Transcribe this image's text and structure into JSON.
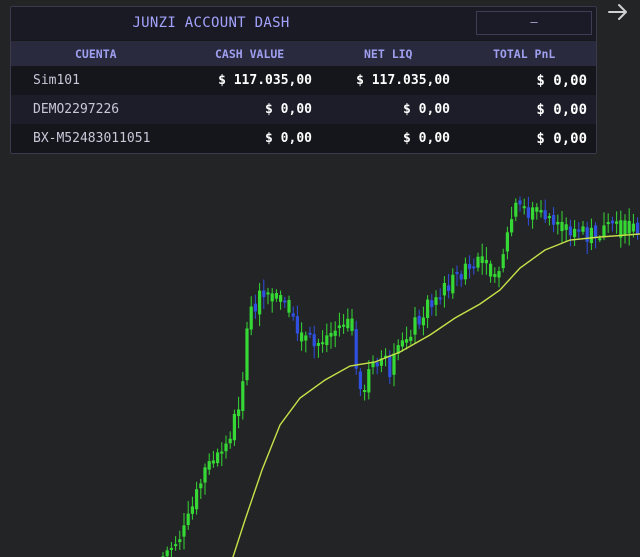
{
  "dashboard": {
    "title": "JUNZI ACCOUNT DASH",
    "minimize_label": "–",
    "columns": [
      "CUENTA",
      "CASH VALUE",
      "NET LIQ",
      "TOTAL PnL"
    ],
    "rows": [
      {
        "account": "Sim101",
        "cash_value": "$ 117.035,00",
        "net_liq": "$ 117.035,00",
        "total_pnl": "$ 0,00"
      },
      {
        "account": "DEMO2297226",
        "cash_value": "$ 0,00",
        "net_liq": "$ 0,00",
        "total_pnl": "$ 0,00"
      },
      {
        "account": "BX-M52483011051",
        "cash_value": "$ 0,00",
        "net_liq": "$ 0,00",
        "total_pnl": "$ 0,00"
      }
    ]
  },
  "toolbar": {
    "arrow_icon": "arrow-right-icon"
  },
  "colors": {
    "background": "#232425",
    "bull_candle": "#35d835",
    "bear_candle": "#3050e0",
    "moving_average": "#c8e04a",
    "header_text": "#a3a3ff"
  }
}
